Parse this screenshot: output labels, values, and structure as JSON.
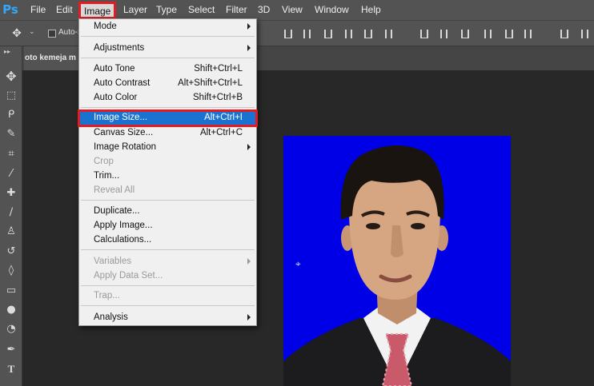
{
  "app": {
    "logo": "Ps"
  },
  "menubar": {
    "items": [
      "File",
      "Edit",
      "Image",
      "Layer",
      "Type",
      "Select",
      "Filter",
      "3D",
      "View",
      "Window",
      "Help"
    ]
  },
  "options_bar": {
    "auto_select_label": "Auto-S"
  },
  "document": {
    "tab_title": "oto kemeja m"
  },
  "image_menu": {
    "items": [
      {
        "label": "Mode",
        "shortcut": "",
        "submenu": true,
        "disabled": false
      },
      {
        "label": "Adjustments",
        "shortcut": "",
        "submenu": true,
        "disabled": false
      },
      {
        "label": "Auto Tone",
        "shortcut": "Shift+Ctrl+L",
        "submenu": false,
        "disabled": false
      },
      {
        "label": "Auto Contrast",
        "shortcut": "Alt+Shift+Ctrl+L",
        "submenu": false,
        "disabled": false
      },
      {
        "label": "Auto Color",
        "shortcut": "Shift+Ctrl+B",
        "submenu": false,
        "disabled": false
      },
      {
        "label": "Image Size...",
        "shortcut": "Alt+Ctrl+I",
        "submenu": false,
        "disabled": false,
        "highlighted": true
      },
      {
        "label": "Canvas Size...",
        "shortcut": "Alt+Ctrl+C",
        "submenu": false,
        "disabled": false
      },
      {
        "label": "Image Rotation",
        "shortcut": "",
        "submenu": true,
        "disabled": false
      },
      {
        "label": "Crop",
        "shortcut": "",
        "submenu": false,
        "disabled": true
      },
      {
        "label": "Trim...",
        "shortcut": "",
        "submenu": false,
        "disabled": false
      },
      {
        "label": "Reveal All",
        "shortcut": "",
        "submenu": false,
        "disabled": true
      },
      {
        "label": "Duplicate...",
        "shortcut": "",
        "submenu": false,
        "disabled": false
      },
      {
        "label": "Apply Image...",
        "shortcut": "",
        "submenu": false,
        "disabled": false
      },
      {
        "label": "Calculations...",
        "shortcut": "",
        "submenu": false,
        "disabled": false
      },
      {
        "label": "Variables",
        "shortcut": "",
        "submenu": true,
        "disabled": true
      },
      {
        "label": "Apply Data Set...",
        "shortcut": "",
        "submenu": false,
        "disabled": true
      },
      {
        "label": "Trap...",
        "shortcut": "",
        "submenu": false,
        "disabled": true
      },
      {
        "label": "Analysis",
        "shortcut": "",
        "submenu": true,
        "disabled": false
      }
    ]
  },
  "colors": {
    "photo_background": "#0000e6",
    "highlight": "#1a73d0",
    "annotation_box": "#e31b23",
    "ps_logo": "#31a8ff"
  },
  "tools": [
    "move-tool-icon",
    "marquee-tool-icon",
    "lasso-tool-icon",
    "quick-select-tool-icon",
    "crop-tool-icon",
    "eyedropper-tool-icon",
    "healing-brush-tool-icon",
    "brush-tool-icon",
    "clone-stamp-tool-icon",
    "history-brush-tool-icon",
    "eraser-tool-icon",
    "gradient-tool-icon",
    "blur-tool-icon",
    "dodge-tool-icon",
    "pen-tool-icon",
    "type-tool-icon"
  ]
}
